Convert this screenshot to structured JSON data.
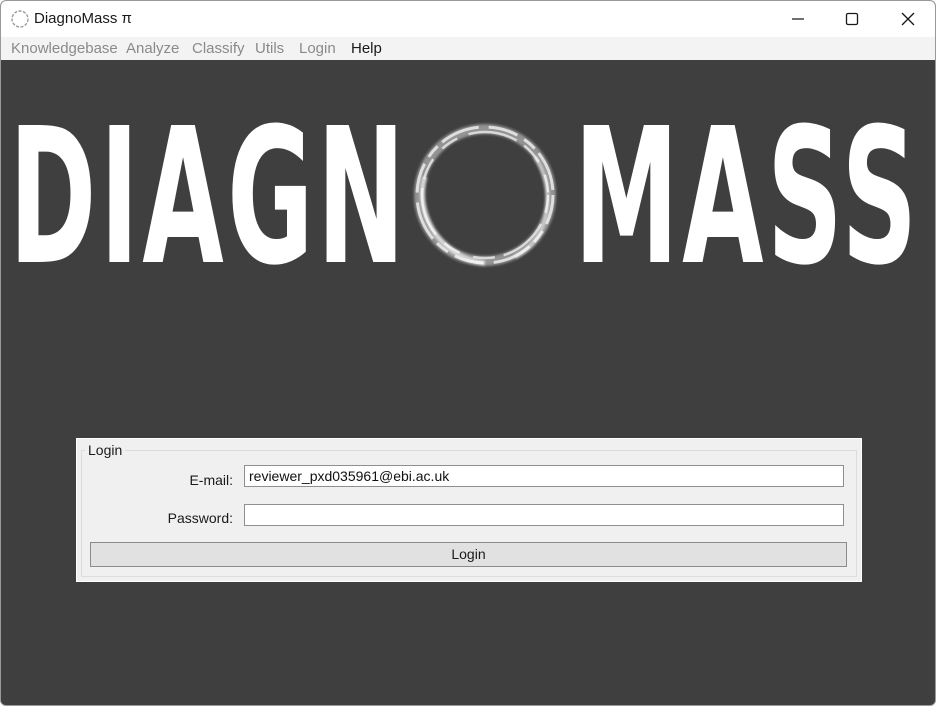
{
  "window": {
    "title": "DiagnoMass π",
    "icon": "diagnomass-ring-icon",
    "controls": [
      "minimize-icon",
      "maximize-icon",
      "close-icon"
    ]
  },
  "menu": {
    "items": [
      {
        "label": "Knowledgebase",
        "enabled": false
      },
      {
        "label": "Analyze",
        "enabled": false
      },
      {
        "label": "Classify",
        "enabled": false
      },
      {
        "label": "Utils",
        "enabled": false
      },
      {
        "label": "Login",
        "enabled": false
      },
      {
        "label": "Help",
        "enabled": true
      }
    ]
  },
  "banner": {
    "logo_left": "DIAGN",
    "logo_right": "MASS",
    "background": "#3f3f3f"
  },
  "login": {
    "group_title": "Login",
    "email_label": "E-mail:",
    "email_value": "reviewer_pxd035961@ebi.ac.uk",
    "password_label": "Password:",
    "password_value": "",
    "button_label": "Login"
  }
}
